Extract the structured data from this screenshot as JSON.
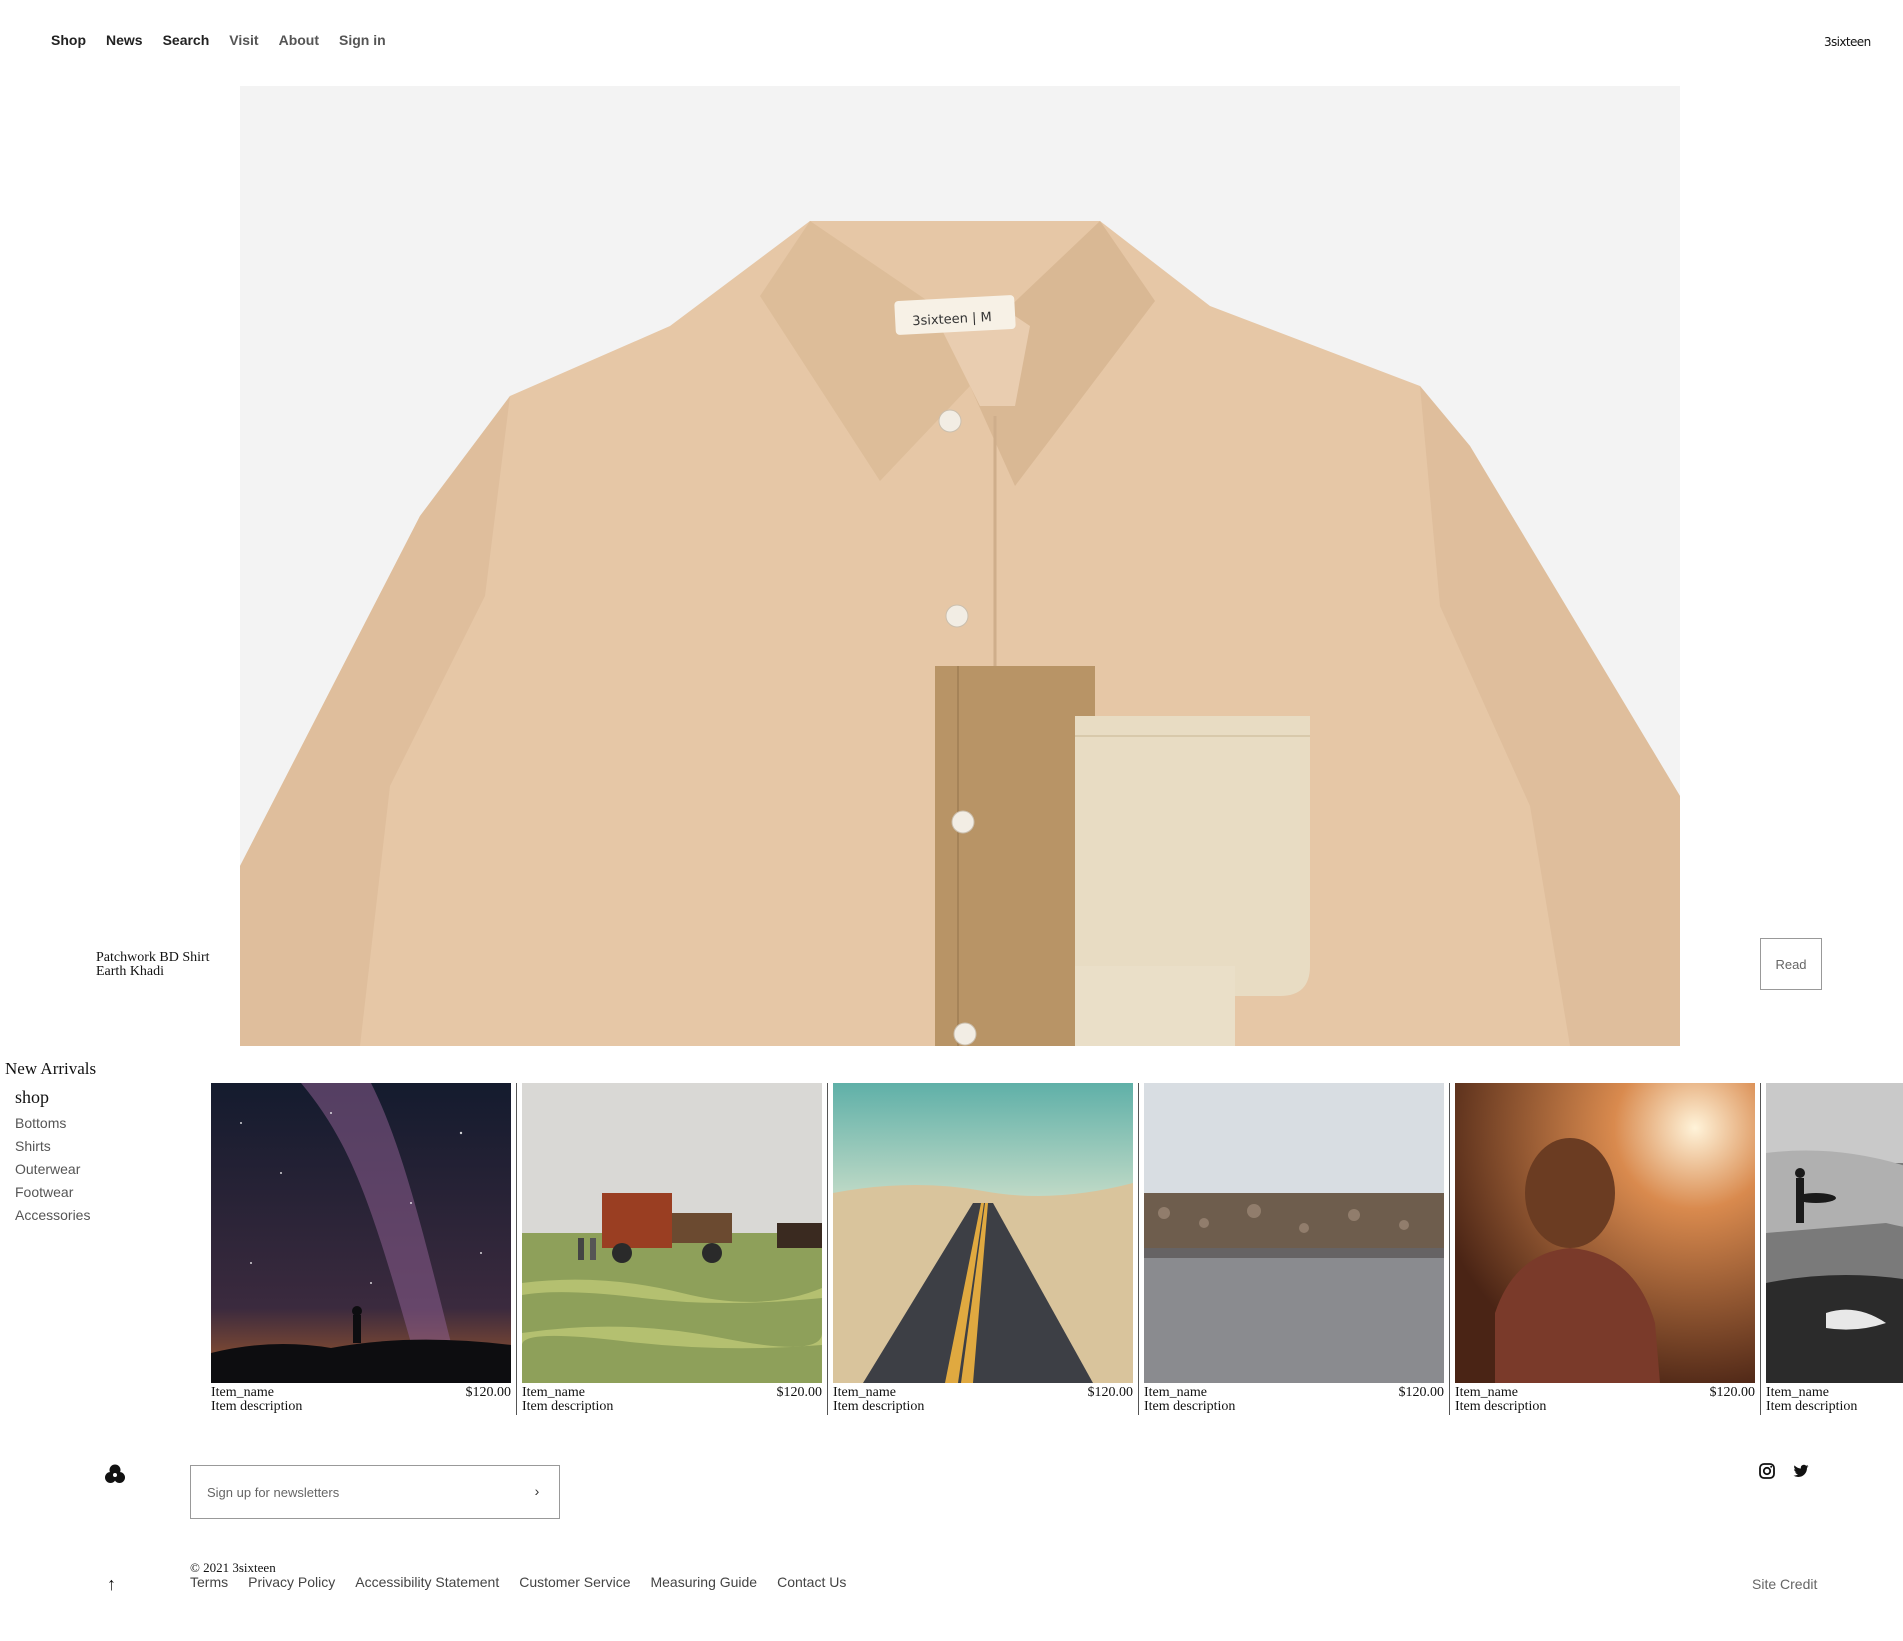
{
  "brand": {
    "logo_text": "3sixteen"
  },
  "topnav": [
    "Shop",
    "News",
    "Search",
    "Visit",
    "About",
    "Sign in"
  ],
  "hero": {
    "label_text": "3sixteen | M",
    "product_name": "Patchwork BD Shirt",
    "product_color": "Earth Khadi",
    "read_label": "Read"
  },
  "new_arrivals": {
    "heading": "New Arrivals"
  },
  "sidebar": {
    "heading": "shop",
    "items": [
      "Bottoms",
      "Shirts",
      "Outerwear",
      "Footwear",
      "Accessories"
    ]
  },
  "products": [
    {
      "name": "Item_name",
      "description": "Item description",
      "price": "$120.00",
      "image": "milky-way-night"
    },
    {
      "name": "Item_name",
      "description": "Item description",
      "price": "$120.00",
      "image": "farm-hay-baler"
    },
    {
      "name": "Item_name",
      "description": "Item description",
      "price": "$120.00",
      "image": "desert-road"
    },
    {
      "name": "Item_name",
      "description": "Item description",
      "price": "$120.00",
      "image": "rocky-shore-lake"
    },
    {
      "name": "Item_name",
      "description": "Item description",
      "price": "$120.00",
      "image": "sunset-portrait"
    },
    {
      "name": "Item_name",
      "description": "Item description",
      "price": "",
      "image": "surfer-beach-bw"
    }
  ],
  "footer": {
    "newsletter_placeholder": "Sign up for newsletters",
    "copyright": "© 2021 3sixteen",
    "links": [
      "Terms",
      "Privacy Policy",
      "Accessibility Statement",
      "Customer Service",
      "Measuring Guide",
      "Contact Us"
    ],
    "site_credit": "Site Credit",
    "social": [
      "instagram-icon",
      "twitter-icon"
    ]
  },
  "colors": {
    "shirt": "#e6c7a6",
    "patch_dark": "#b89466",
    "pocket": "#e8dcc3",
    "hero_bg": "#f3f3f3"
  }
}
